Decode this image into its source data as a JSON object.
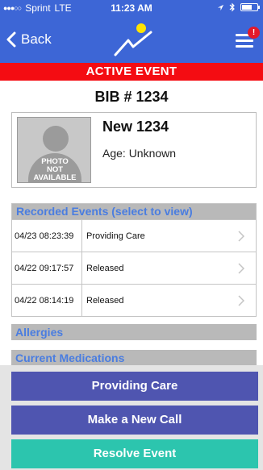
{
  "status_bar": {
    "carrier": "Sprint",
    "network": "LTE",
    "time": "11:23 AM",
    "signal_icon": "signal-dots-icon",
    "location_icon": "location-arrow-icon",
    "bluetooth_icon": "bluetooth-icon",
    "battery_icon": "battery-icon"
  },
  "nav": {
    "back_label": "Back",
    "menu_badge": "!"
  },
  "banner": {
    "label": "ACTIVE EVENT",
    "color": "#f40c12"
  },
  "bib_label": "BIB # 1234",
  "profile": {
    "photo_text": [
      "PHOTO",
      "NOT",
      "AVAILABLE"
    ],
    "name": "New 1234",
    "age": "Age: Unknown"
  },
  "events": {
    "header": "Recorded Events (select to view)",
    "rows": [
      {
        "date": "04/23 08:23:39",
        "desc": "Providing Care"
      },
      {
        "date": "04/22 09:17:57",
        "desc": "Released"
      },
      {
        "date": "04/22 08:14:19",
        "desc": "Released"
      }
    ]
  },
  "sections": {
    "allergies": "Allergies",
    "medications": "Current Medications"
  },
  "actions": {
    "providing_care": "Providing Care",
    "new_call": "Make a New Call",
    "resolve": "Resolve Event"
  },
  "colors": {
    "header_blue": "#3d66d6",
    "action_purple": "#4f55b0",
    "resolve_teal": "#2cc5ae",
    "section_text_blue": "#4a7de0"
  }
}
